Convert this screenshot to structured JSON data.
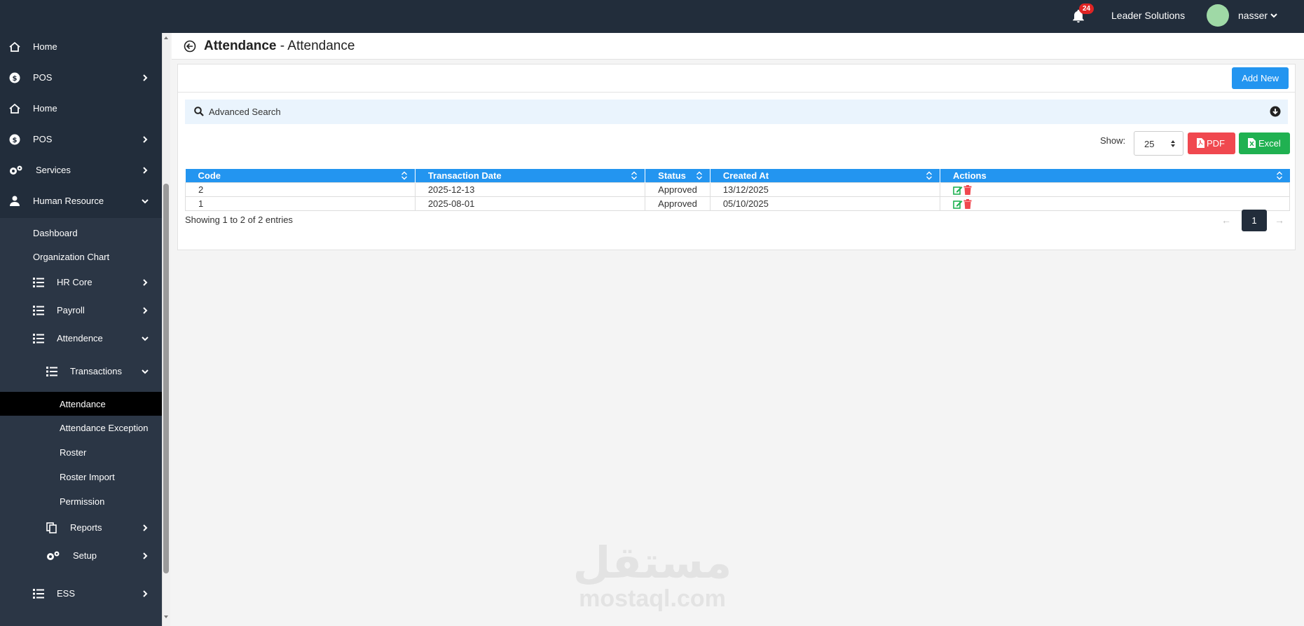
{
  "topbar": {
    "notification_count": "24",
    "company": "Leader Solutions",
    "username": "nasser"
  },
  "sidebar": {
    "items": [
      {
        "label": "Home",
        "icon": "home-icon"
      },
      {
        "label": "POS",
        "icon": "dollar-circle-icon"
      },
      {
        "label": "Home",
        "icon": "home-icon"
      },
      {
        "label": "POS",
        "icon": "dollar-circle-icon"
      },
      {
        "label": "Services",
        "icon": "gears-icon"
      },
      {
        "label": "Human Resource",
        "icon": "user-icon"
      }
    ],
    "hr_sub": {
      "dashboard": "Dashboard",
      "org_chart": "Organization Chart",
      "hr_core": "HR Core",
      "payroll": "Payroll",
      "attendence": "Attendence",
      "transactions": "Transactions",
      "transactions_items": [
        "Attendance",
        "Attendance Exception",
        "Roster",
        "Roster Import",
        "Permission"
      ],
      "reports": "Reports",
      "setup": "Setup"
    },
    "ess": "ESS"
  },
  "header": {
    "title_bold": "Attendance",
    "title_rest": " - Attendance"
  },
  "toolbar": {
    "add_new": "Add New",
    "advanced_search": "Advanced Search",
    "show_label": "Show:",
    "page_size": "25",
    "pdf": "PDF",
    "excel": "Excel"
  },
  "table": {
    "columns": [
      "Code",
      "Transaction Date",
      "Status",
      "Created At",
      "Actions"
    ],
    "rows": [
      {
        "code": "2",
        "date": "2025-12-13",
        "status": "Approved",
        "created": "13/12/2025"
      },
      {
        "code": "1",
        "date": "2025-08-01",
        "status": "Approved",
        "created": "05/10/2025"
      }
    ]
  },
  "footer": {
    "info": "Showing 1 to 2 of 2 entries",
    "prev": "←",
    "current_page": "1",
    "next": "→"
  },
  "watermark": {
    "arabic": "مستقل",
    "latin": "mostaql.com"
  },
  "colors": {
    "dark": "#222d3b",
    "accent": "#2395f0",
    "pdf": "#f0484f",
    "excel": "#20b151",
    "approved": "#1f8a2b"
  }
}
